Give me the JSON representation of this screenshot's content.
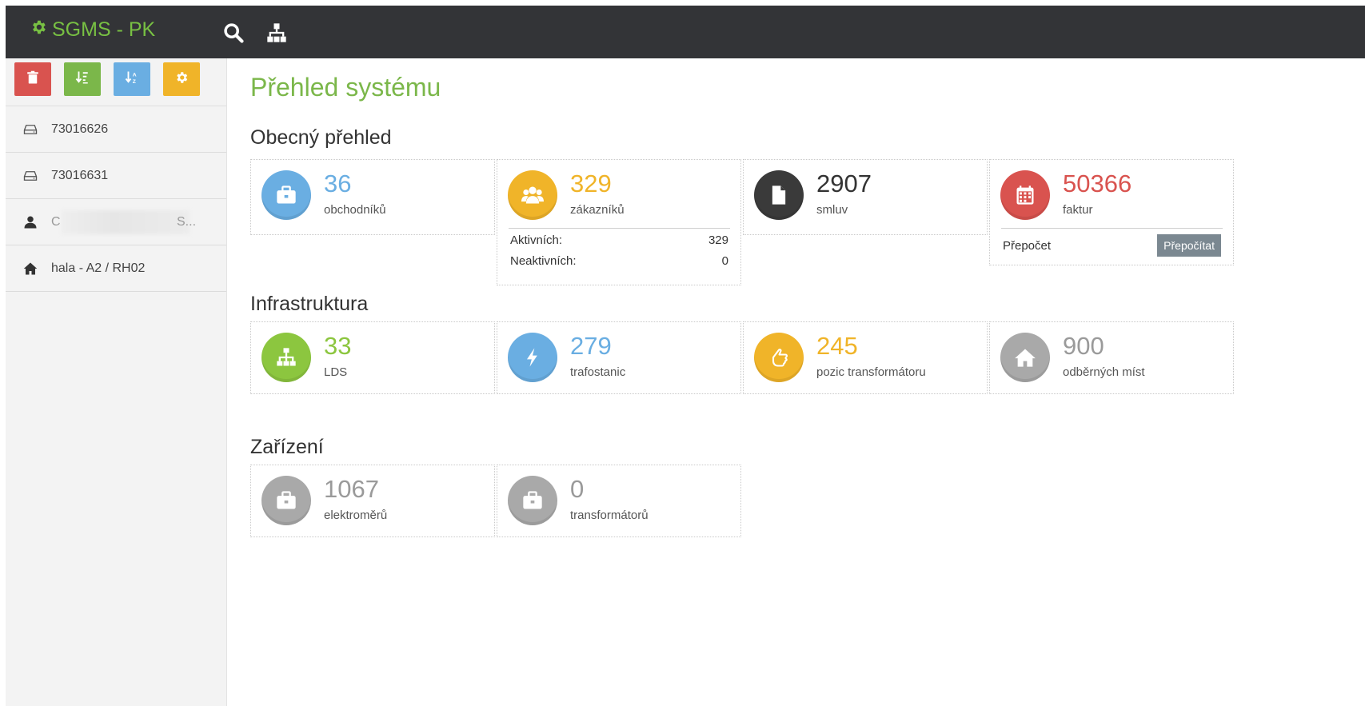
{
  "app": {
    "brand": "SGMS - PK"
  },
  "colors": {
    "brand_green": "#78c043",
    "title_green": "#7bb74a",
    "blue": "#6aaee2",
    "orange": "#f0b429",
    "red": "#d9534f",
    "dark": "#3a3a3a",
    "gray": "#a9a9a9",
    "lime": "#8cc63f"
  },
  "sidebar": {
    "items": [
      {
        "label": "73016626",
        "icon": "drive-icon"
      },
      {
        "label": "73016631",
        "icon": "drive-icon"
      },
      {
        "label": "C",
        "label_tail": "S...",
        "icon": "user-icon"
      },
      {
        "label": "hala - A2 / RH02",
        "icon": "home-icon"
      }
    ]
  },
  "main": {
    "title": "Přehled systému",
    "sections": [
      {
        "title": "Obecný přehled",
        "cards": [
          {
            "value": "36",
            "label": "obchodníků",
            "icon": "briefcase-icon",
            "color": "#6aaee2"
          },
          {
            "value": "329",
            "label": "zákazníků",
            "icon": "users-icon",
            "color": "#f0b429",
            "stats": [
              {
                "label": "Aktivních:",
                "value": "329"
              },
              {
                "label": "Neaktivních:",
                "value": "0"
              }
            ]
          },
          {
            "value": "2907",
            "label": "smluv",
            "icon": "document-icon",
            "color": "#3a3a3a"
          },
          {
            "value": "50366",
            "label": "faktur",
            "icon": "calendar-icon",
            "color": "#d9534f",
            "recalc": {
              "label": "Přepočet",
              "button": "Přepočítat"
            }
          }
        ]
      },
      {
        "title": "Infrastruktura",
        "cards": [
          {
            "value": "33",
            "label": "LDS",
            "icon": "sitemap-icon",
            "color": "#8cc63f"
          },
          {
            "value": "279",
            "label": "trafostanic",
            "icon": "bolt-icon",
            "color": "#6aaee2"
          },
          {
            "value": "245",
            "label": "pozic transformátoru",
            "icon": "hand-pointer-icon",
            "color": "#f0b429"
          },
          {
            "value": "900",
            "label": "odběrných míst",
            "icon": "home-icon",
            "color": "#a9a9a9"
          }
        ]
      },
      {
        "title": "Zařízení",
        "cards": [
          {
            "value": "1067",
            "label": "elektroměrů",
            "icon": "briefcase-icon",
            "color": "#a9a9a9"
          },
          {
            "value": "0",
            "label": "transformátorů",
            "icon": "briefcase-icon",
            "color": "#a9a9a9"
          }
        ]
      }
    ]
  }
}
